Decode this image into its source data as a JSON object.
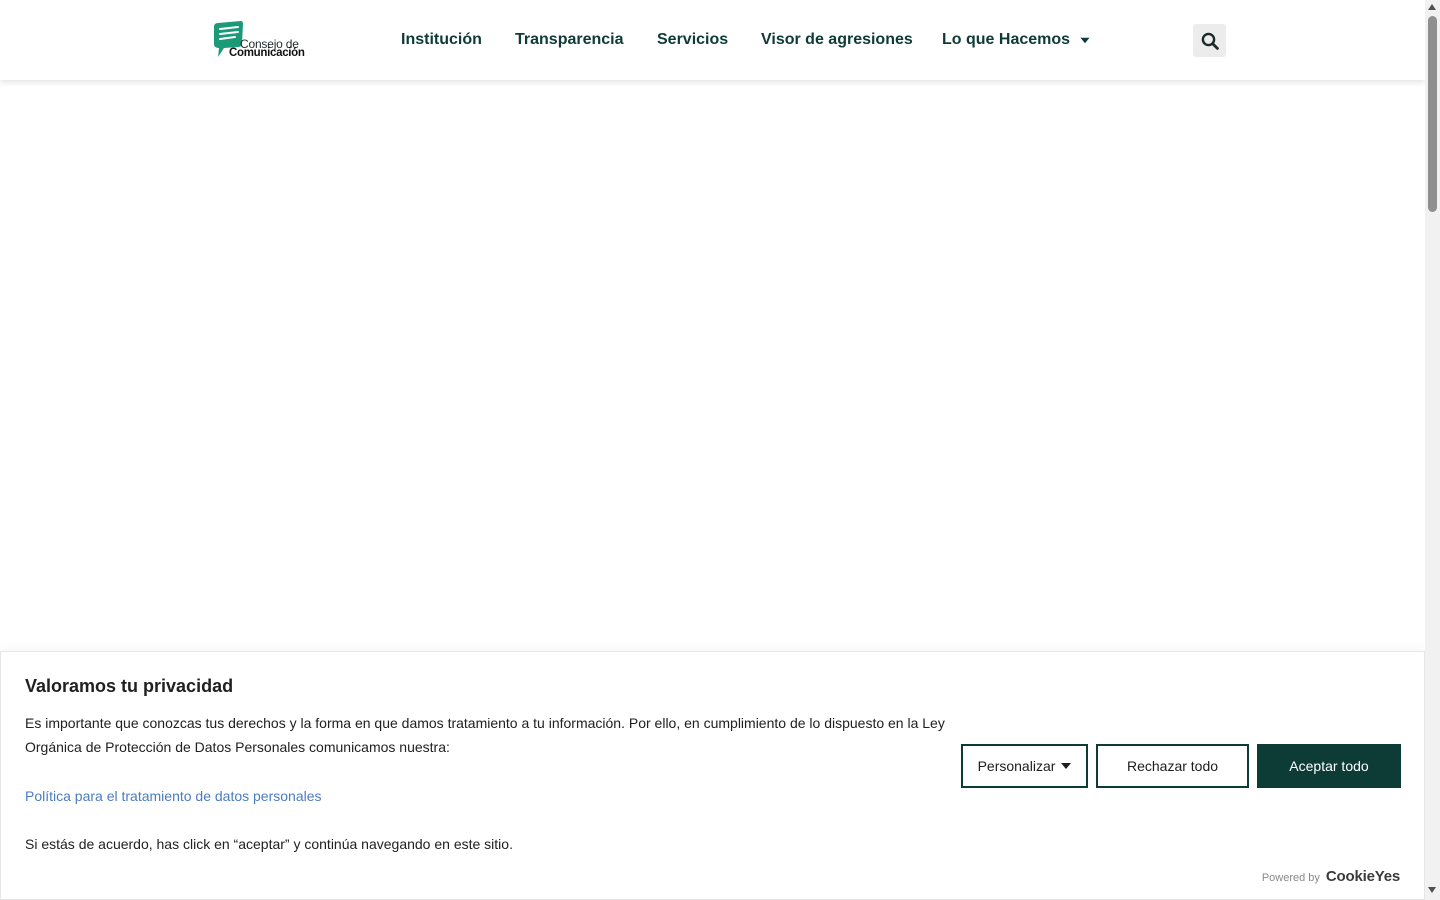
{
  "logo": {
    "line1": "Consejo de",
    "line2": "Comunicación",
    "brand_color": "#1a9a77"
  },
  "nav": {
    "items": [
      {
        "label": "Institución"
      },
      {
        "label": "Transparencia"
      },
      {
        "label": "Servicios"
      },
      {
        "label": "Visor de agresiones"
      },
      {
        "label": "Lo que Hacemos",
        "has_dropdown": true
      }
    ],
    "search_icon": "search-icon"
  },
  "cookie_banner": {
    "title": "Valoramos tu privacidad",
    "text": "Es importante que conozcas tus derechos y la forma en que damos tratamiento a tu información. Por ello, en cumplimiento de lo dispuesto en la Ley Orgánica de Protección de Datos Personales comunicamos nuestra:",
    "link": "Política para el tratamiento de datos personales",
    "agree_text": "Si estás de acuerdo, has click en “aceptar” y continúa navegando en este sitio.",
    "buttons": {
      "customize": "Personalizar",
      "reject": "Rechazar todo",
      "accept": "Aceptar todo"
    },
    "powered_by": "Powered by",
    "powered_brand": "CookieYes"
  },
  "colors": {
    "primary_dark": "#0d3b35",
    "link": "#4a7cc2"
  }
}
